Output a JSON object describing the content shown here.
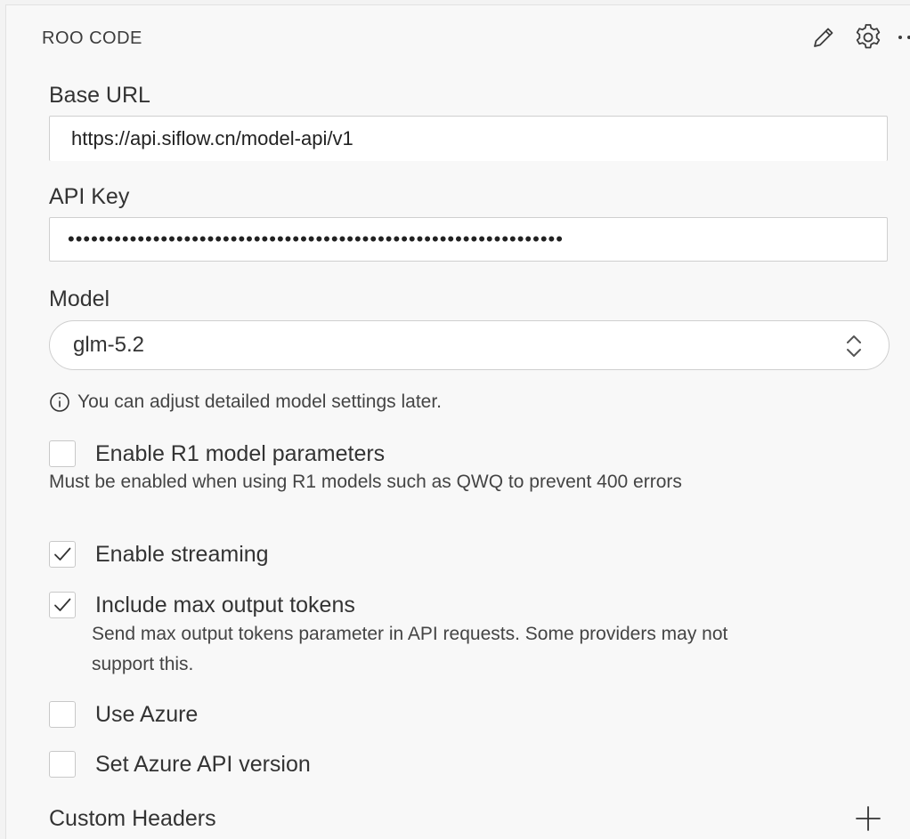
{
  "header": {
    "title": "ROO CODE",
    "icons": [
      "pencil-icon",
      "gear-icon",
      "more-icon"
    ]
  },
  "base_url": {
    "label": "Base URL",
    "value": "https://api.siflow.cn/model-api/v1"
  },
  "api_key": {
    "label": "API Key",
    "value": "••••••••••••••••••••••••••••••••••••••••••••••••••••••••••••••••"
  },
  "model": {
    "label": "Model",
    "selected": "glm-5.2"
  },
  "info": {
    "text": "You can adjust detailed model settings later."
  },
  "options": {
    "r1": {
      "label": "Enable R1 model parameters",
      "checked": false,
      "description": "Must be enabled when using R1 models such as QWQ to prevent 400 errors"
    },
    "streaming": {
      "label": "Enable streaming",
      "checked": true
    },
    "max_tokens": {
      "label": "Include max output tokens",
      "checked": true,
      "description_line1": "Send max output tokens parameter in API requests. Some providers may not",
      "description_line2": "support this."
    },
    "azure": {
      "label": "Use Azure",
      "checked": false
    },
    "azure_version": {
      "label": "Set Azure API version",
      "checked": false
    }
  },
  "custom_headers": {
    "title": "Custom Headers"
  },
  "colors": {
    "background": "#f8f8f8",
    "input_border": "#cfcfcf",
    "text": "#333333"
  }
}
